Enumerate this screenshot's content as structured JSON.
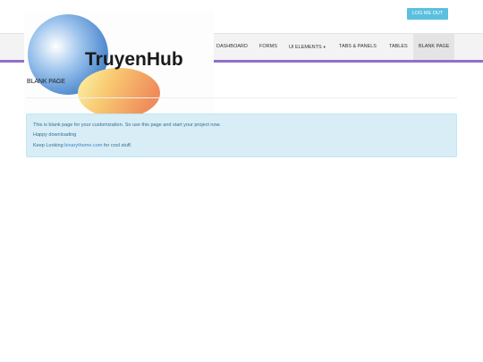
{
  "header": {
    "logout_label": "LOG ME OUT"
  },
  "logo": {
    "text": "TruyenHub"
  },
  "nav": {
    "items": [
      {
        "label": "DASHBOARD"
      },
      {
        "label": "FORMS"
      },
      {
        "label": "UI ELEMENTS"
      },
      {
        "label": "TABS & PANELS"
      },
      {
        "label": "TABLES"
      },
      {
        "label": "BLANK PAGE"
      }
    ]
  },
  "page": {
    "title": "BLANK PAGE"
  },
  "alert": {
    "line1": "This is blank page for your customization. So use this page and start your project now.",
    "line2": "Happy downloading",
    "line3_prefix": "Keep Looking ",
    "line3_link": "binarytheme.com",
    "line3_suffix": " for cool stuff."
  },
  "colors": {
    "nav_accent": "#9170cb",
    "button": "#5bc0de",
    "alert_bg": "#d9edf7",
    "alert_text": "#31708f",
    "logo_text": "#1a1a1a",
    "logo_accent": "#5aa03c"
  }
}
